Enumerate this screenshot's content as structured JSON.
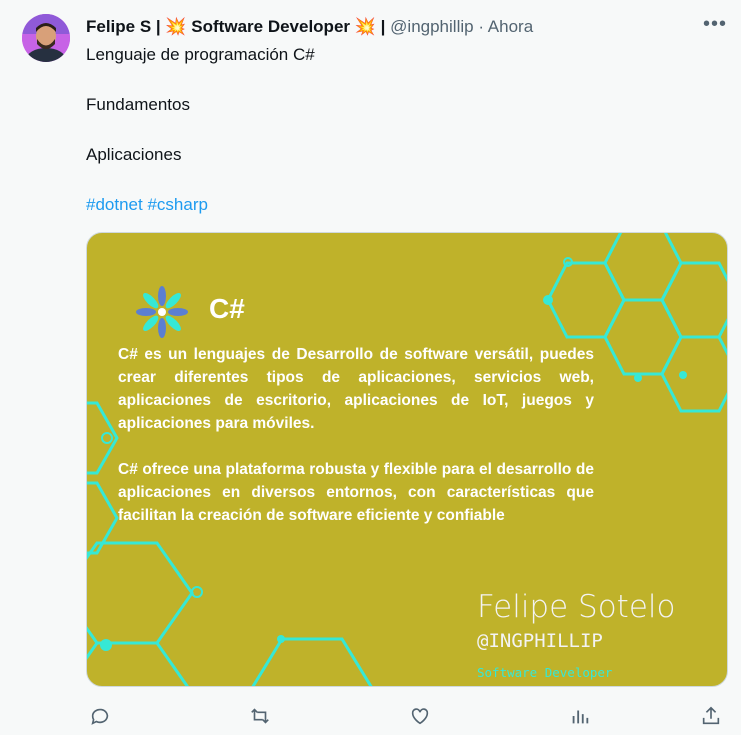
{
  "author": {
    "display_name": "Felipe S",
    "bio_tag": "Software Developer",
    "handle": "@ingphillip",
    "separator": "·",
    "time": "Ahora"
  },
  "tweet": {
    "line1": "Lenguaje de programación C#",
    "line2": "Fundamentos",
    "line3": "Aplicaciones",
    "hashtags": [
      "#dotnet",
      "#csharp"
    ]
  },
  "media": {
    "title": "C#",
    "paragraph1": "C# es un lenguajes de Desarrollo de software versátil, puedes crear diferentes tipos de aplicaciones, servicios web, aplicaciones de escritorio, aplicaciones de IoT, juegos y aplicaciones para móviles.",
    "paragraph2": "C# ofrece una plataforma robusta y flexible para el desarrollo de aplicaciones en diversos entornos, con características que facilitan la creación de software eficiente y confiable",
    "signature_name": "Felipe Sotelo",
    "signature_handle": "@INGPHILLIP",
    "signature_role": "Software Developer",
    "background_color": "#bfb22a",
    "accent_color": "#36e8d6"
  },
  "actions": [
    "reply-icon",
    "retweet-icon",
    "like-icon",
    "analytics-icon",
    "share-icon"
  ],
  "colors": {
    "link": "#1d9bf0",
    "muted": "#536471"
  }
}
